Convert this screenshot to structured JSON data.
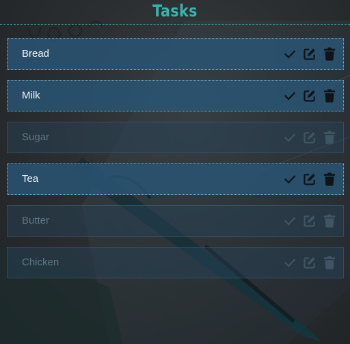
{
  "header": {
    "title": "Tasks"
  },
  "colors": {
    "accent": "#36b5ad",
    "active_row": "#2a5676",
    "done_row": "#26465c",
    "active_text": "#f2f5f7",
    "done_text": "#5e7685"
  },
  "tasks": [
    {
      "label": "Bread",
      "completed": false,
      "icons": [
        "check-icon",
        "edit-icon",
        "trash-icon"
      ]
    },
    {
      "label": "Milk",
      "completed": false,
      "icons": [
        "check-icon",
        "edit-icon",
        "trash-icon"
      ]
    },
    {
      "label": "Sugar",
      "completed": true,
      "icons": [
        "check-icon",
        "edit-icon",
        "trash-icon"
      ]
    },
    {
      "label": "Tea",
      "completed": false,
      "icons": [
        "check-icon",
        "edit-icon",
        "trash-icon"
      ]
    },
    {
      "label": "Butter",
      "completed": true,
      "icons": [
        "check-icon",
        "edit-icon",
        "trash-icon"
      ]
    },
    {
      "label": "Chicken",
      "completed": true,
      "icons": [
        "check-icon",
        "edit-icon",
        "trash-icon"
      ]
    }
  ]
}
